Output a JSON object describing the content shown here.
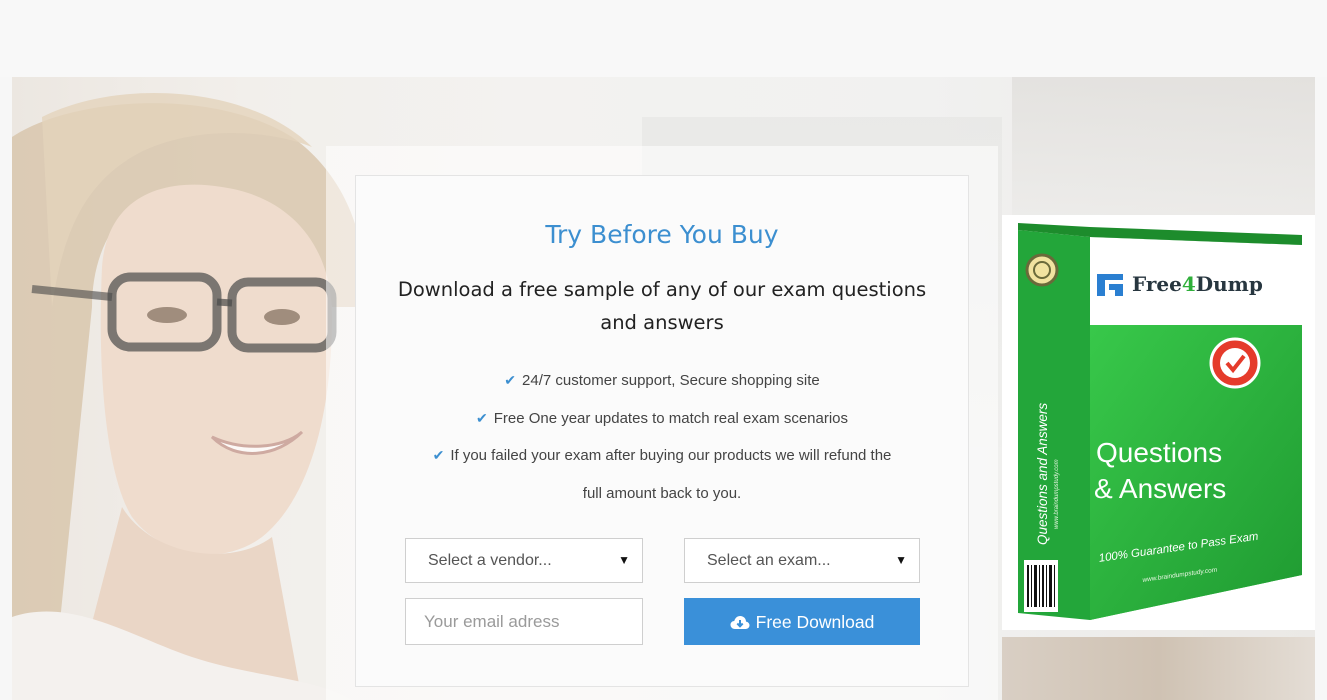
{
  "hero": {
    "title": "Try Before You Buy",
    "subtitle": "Download a free sample of any of our exam questions and answers",
    "features": [
      "24/7 customer support, Secure shopping site",
      "Free One year updates to match real exam scenarios",
      "If you failed your exam after buying our products we will refund the",
      "full amount back to you."
    ]
  },
  "form": {
    "vendor_select": "Select a vendor...",
    "exam_select": "Select an exam...",
    "email_placeholder": "Your email adress",
    "download_label": "Free Download"
  },
  "product_box": {
    "brand_prefix": "Free",
    "brand_four": "4",
    "brand_suffix": "Dump",
    "side_text": "Questions and Answers",
    "side_url": "www.braindumpstudy.com",
    "qa_line1": "Questions",
    "qa_line2": "& Answers",
    "guarantee": "100% Guarantee to Pass Exam",
    "site_url": "www.braindumpstudy.com"
  },
  "icons": {
    "feature_check": "check-icon",
    "download": "cloud-download-icon",
    "select_arrow": "caret-down-icon"
  },
  "colors": {
    "accent": "#3a90d9",
    "title": "#3c8fd0",
    "product_green": "#2faf3a"
  }
}
